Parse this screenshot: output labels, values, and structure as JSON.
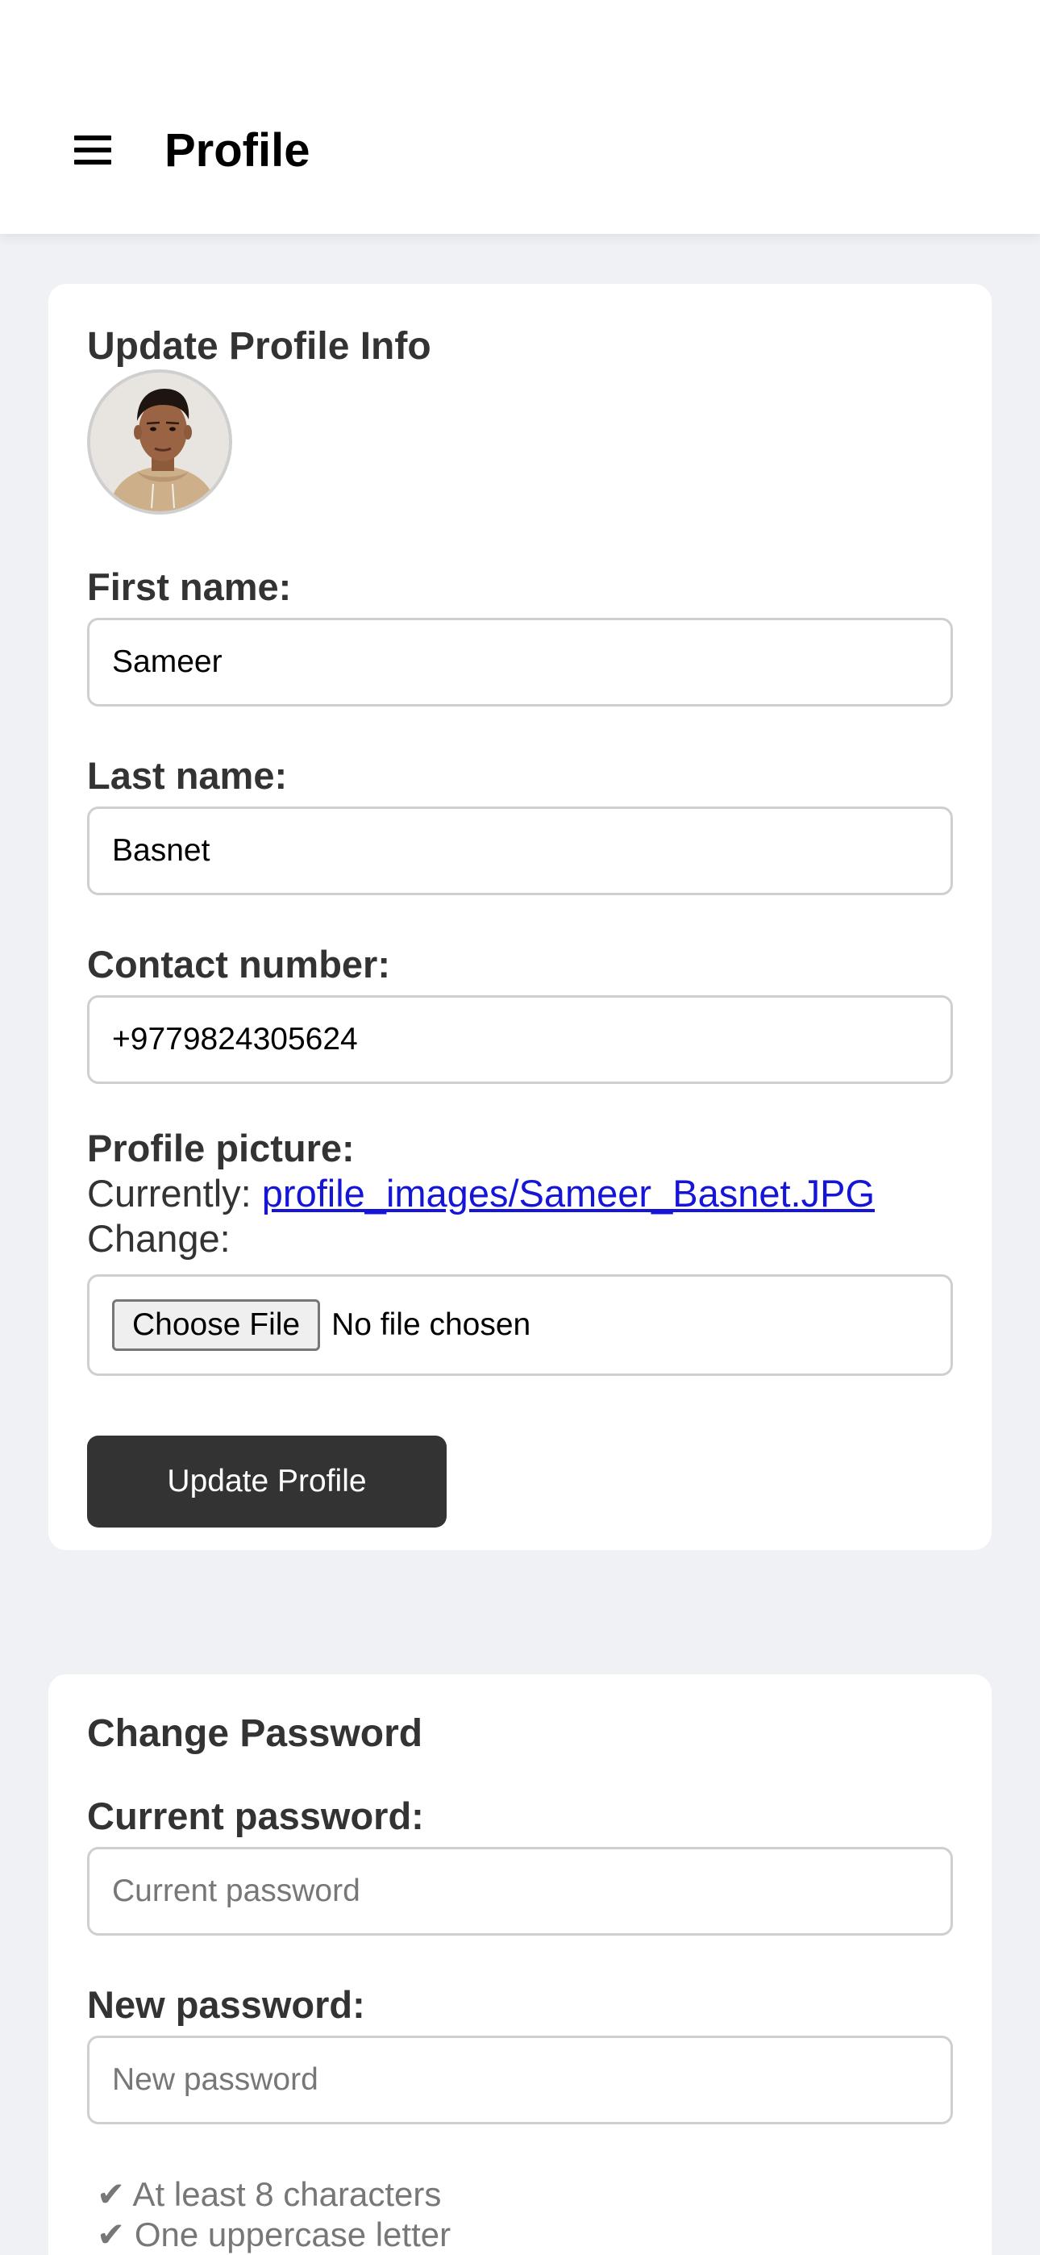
{
  "header": {
    "title": "Profile",
    "menu_icon": "hamburger-menu-icon"
  },
  "profile_card": {
    "title": "Update Profile Info",
    "avatar_alt": "Profile picture of Sameer Basnet",
    "first_name": {
      "label": "First name:",
      "value": "Sameer"
    },
    "last_name": {
      "label": "Last name:",
      "value": "Basnet"
    },
    "contact": {
      "label": "Contact number:",
      "value": "+9779824305624"
    },
    "picture": {
      "label": "Profile picture:",
      "currently_label": "Currently:",
      "current_file": "profile_images/Sameer_Basnet.JPG",
      "change_label": "Change:",
      "choose_button": "Choose File",
      "file_status": "No file chosen"
    },
    "submit_label": "Update Profile"
  },
  "password_card": {
    "title": "Change Password",
    "current": {
      "label": "Current password:",
      "placeholder": "Current password"
    },
    "new": {
      "label": "New password:",
      "placeholder": "New password"
    },
    "requirements": [
      "✔ At least 8 characters",
      "✔ One uppercase letter"
    ]
  },
  "colors": {
    "background": "#f0f1f5",
    "card": "#ffffff",
    "primary_button": "#333333",
    "link": "#1515d8"
  }
}
